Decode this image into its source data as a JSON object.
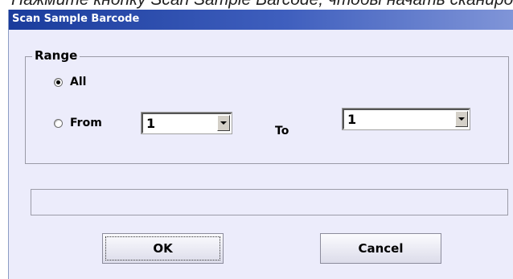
{
  "background_caption": "Нажмите кнопку Scan Sample Barcode, чтобы начать сканирование",
  "dialog": {
    "title": "Scan Sample Barcode",
    "range_label": "Range",
    "all_label": "All",
    "from_label": "From",
    "to_label": "To",
    "from_value": "1",
    "to_value": "1",
    "ok_label": "OK",
    "cancel_label": "Cancel",
    "selected_option": "All"
  },
  "colors": {
    "titlebar_start": "#1a3c9c",
    "titlebar_end": "#8095d8",
    "dialog_background": "#ececfb"
  }
}
